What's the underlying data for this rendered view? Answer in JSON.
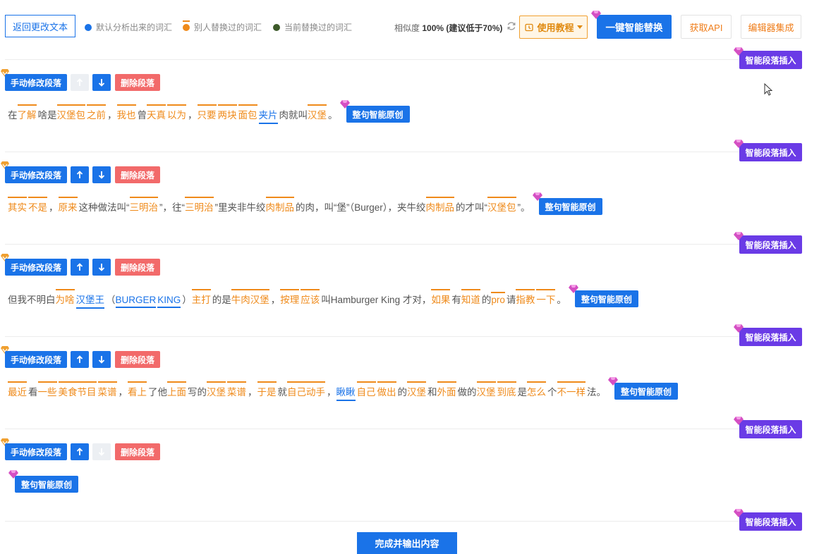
{
  "topbar": {
    "back_label": "返回更改文本",
    "legend": [
      {
        "label": "默认分析出来的词汇",
        "color": "#1a73e8"
      },
      {
        "label": "别人替换过的词汇",
        "color": "#ef8a1a"
      },
      {
        "label": "当前替换过的词汇",
        "color": "#3d5a2a"
      }
    ],
    "similarity_label": "相似度",
    "similarity_value": "100% (建议低于70%)",
    "refresh_icon": "refresh-icon",
    "guide_label": "使用教程",
    "smart_replace_label": "一键智能替换",
    "api_label": "获取API",
    "editor_label": "编辑器集成"
  },
  "controls": {
    "edit_label": "手动修改段落",
    "delete_label": "删除段落",
    "insert_label": "智能段落插入",
    "rewrite_label": "整句智能原创",
    "finish_label": "完成并输出内容"
  },
  "paragraphs": [
    {
      "up_enabled": false,
      "down_enabled": true,
      "segments": [
        {
          "t": "在",
          "s": "p"
        },
        {
          "t": "了解",
          "s": "o"
        },
        {
          "t": "啥是",
          "s": "p"
        },
        {
          "t": "汉堡包",
          "s": "o"
        },
        {
          "t": "之前",
          "s": "o"
        },
        {
          "t": "，",
          "s": "p"
        },
        {
          "t": "我也",
          "s": "o"
        },
        {
          "t": "曾",
          "s": "p"
        },
        {
          "t": "天真",
          "s": "o"
        },
        {
          "t": "以为",
          "s": "o"
        },
        {
          "t": "，",
          "s": "p"
        },
        {
          "t": "只要",
          "s": "o"
        },
        {
          "t": "两块",
          "s": "o"
        },
        {
          "t": "面包",
          "s": "o"
        },
        {
          "t": "夹片",
          "s": "b"
        },
        {
          "t": "肉就叫",
          "s": "p"
        },
        {
          "t": "汉堡",
          "s": "o"
        },
        {
          "t": "。",
          "s": "p"
        }
      ]
    },
    {
      "up_enabled": true,
      "down_enabled": true,
      "segments": [
        {
          "t": "其实",
          "s": "o"
        },
        {
          "t": "不是",
          "s": "o"
        },
        {
          "t": "，",
          "s": "p"
        },
        {
          "t": "原来",
          "s": "o"
        },
        {
          "t": "这种做法叫“",
          "s": "p"
        },
        {
          "t": "三明治",
          "s": "o"
        },
        {
          "t": "”，往“",
          "s": "p"
        },
        {
          "t": "三明治",
          "s": "o"
        },
        {
          "t": "”里夹非牛绞",
          "s": "p"
        },
        {
          "t": "肉制品",
          "s": "o"
        },
        {
          "t": "的肉，叫“堡”（Burger），夹牛绞",
          "s": "p"
        },
        {
          "t": "肉制品",
          "s": "o"
        },
        {
          "t": "的才叫“",
          "s": "p"
        },
        {
          "t": "汉堡包",
          "s": "o"
        },
        {
          "t": "”。",
          "s": "p"
        }
      ]
    },
    {
      "up_enabled": true,
      "down_enabled": true,
      "segments": [
        {
          "t": "但我不明白",
          "s": "p"
        },
        {
          "t": "为啥",
          "s": "o"
        },
        {
          "t": "汉堡王",
          "s": "b"
        },
        {
          "t": "（",
          "s": "p"
        },
        {
          "t": "BURGER",
          "s": "b"
        },
        {
          "t": "KING",
          "s": "b"
        },
        {
          "t": "）",
          "s": "p"
        },
        {
          "t": "主打",
          "s": "o"
        },
        {
          "t": "的是",
          "s": "p"
        },
        {
          "t": "牛肉汉堡",
          "s": "o"
        },
        {
          "t": "，",
          "s": "p"
        },
        {
          "t": "按理",
          "s": "o"
        },
        {
          "t": "应该",
          "s": "o"
        },
        {
          "t": "叫Hamburger King 才对，",
          "s": "p"
        },
        {
          "t": "如果",
          "s": "o"
        },
        {
          "t": "有",
          "s": "p"
        },
        {
          "t": "知道",
          "s": "o"
        },
        {
          "t": "的",
          "s": "p"
        },
        {
          "t": "pro",
          "s": "o"
        },
        {
          "t": "请",
          "s": "p"
        },
        {
          "t": "指教",
          "s": "o"
        },
        {
          "t": "一下",
          "s": "o"
        },
        {
          "t": "。",
          "s": "p"
        }
      ]
    },
    {
      "up_enabled": true,
      "down_enabled": true,
      "segments": [
        {
          "t": "最近",
          "s": "o"
        },
        {
          "t": "看",
          "s": "p"
        },
        {
          "t": "一些",
          "s": "o"
        },
        {
          "t": "美食节目",
          "s": "o"
        },
        {
          "t": "菜谱",
          "s": "o"
        },
        {
          "t": "，",
          "s": "p"
        },
        {
          "t": "看上",
          "s": "o"
        },
        {
          "t": "了他",
          "s": "p"
        },
        {
          "t": "上面",
          "s": "o"
        },
        {
          "t": "写的",
          "s": "p"
        },
        {
          "t": "汉堡",
          "s": "o"
        },
        {
          "t": "菜谱",
          "s": "o"
        },
        {
          "t": "，",
          "s": "p"
        },
        {
          "t": "于是",
          "s": "o"
        },
        {
          "t": "就",
          "s": "p"
        },
        {
          "t": "自己动手",
          "s": "o"
        },
        {
          "t": "，",
          "s": "p"
        },
        {
          "t": "瞅瞅",
          "s": "b"
        },
        {
          "t": "自己",
          "s": "o"
        },
        {
          "t": "做出",
          "s": "o"
        },
        {
          "t": "的",
          "s": "p"
        },
        {
          "t": "汉堡",
          "s": "o"
        },
        {
          "t": "和",
          "s": "p"
        },
        {
          "t": "外面",
          "s": "o"
        },
        {
          "t": "做的",
          "s": "p"
        },
        {
          "t": "汉堡",
          "s": "o"
        },
        {
          "t": "到底",
          "s": "o"
        },
        {
          "t": "是",
          "s": "p"
        },
        {
          "t": "怎么",
          "s": "o"
        },
        {
          "t": "个",
          "s": "p"
        },
        {
          "t": "不一样",
          "s": "o"
        },
        {
          "t": "法。",
          "s": "p"
        }
      ]
    },
    {
      "up_enabled": true,
      "down_enabled": false,
      "segments": []
    }
  ]
}
